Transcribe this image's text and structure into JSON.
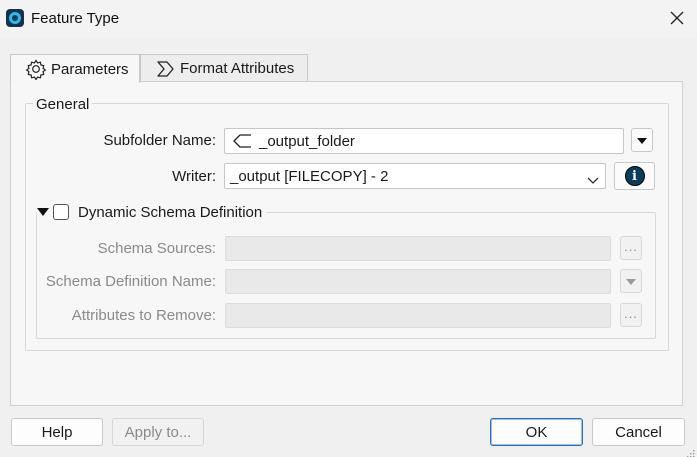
{
  "window": {
    "title": "Feature Type",
    "icon": "fme-app-icon",
    "close_icon": "close-icon"
  },
  "tabs": [
    {
      "label": "Parameters",
      "icon": "gear-icon",
      "active": true
    },
    {
      "label": "Format Attributes",
      "icon": "sigma-icon",
      "active": false
    }
  ],
  "general": {
    "legend": "General",
    "subfolder_label": "Subfolder Name:",
    "subfolder_value": "_output_folder",
    "subfolder_icon": "attribute-value-icon",
    "writer_label": "Writer:",
    "writer_value": "_output [FILECOPY] - 2",
    "info_icon": "info-icon"
  },
  "dynamic_schema": {
    "label": "Dynamic Schema Definition",
    "checked": false,
    "expanded": true,
    "schema_sources_label": "Schema Sources:",
    "schema_definition_name_label": "Schema Definition Name:",
    "attributes_to_remove_label": "Attributes to Remove:",
    "ellipsis": "..."
  },
  "footer": {
    "help": "Help",
    "apply_to": "Apply to...",
    "ok": "OK",
    "cancel": "Cancel"
  },
  "colors": {
    "accent": "#2b6fb6",
    "info_icon": "#0b3c5d",
    "app_icon": "#2fb7ea"
  }
}
